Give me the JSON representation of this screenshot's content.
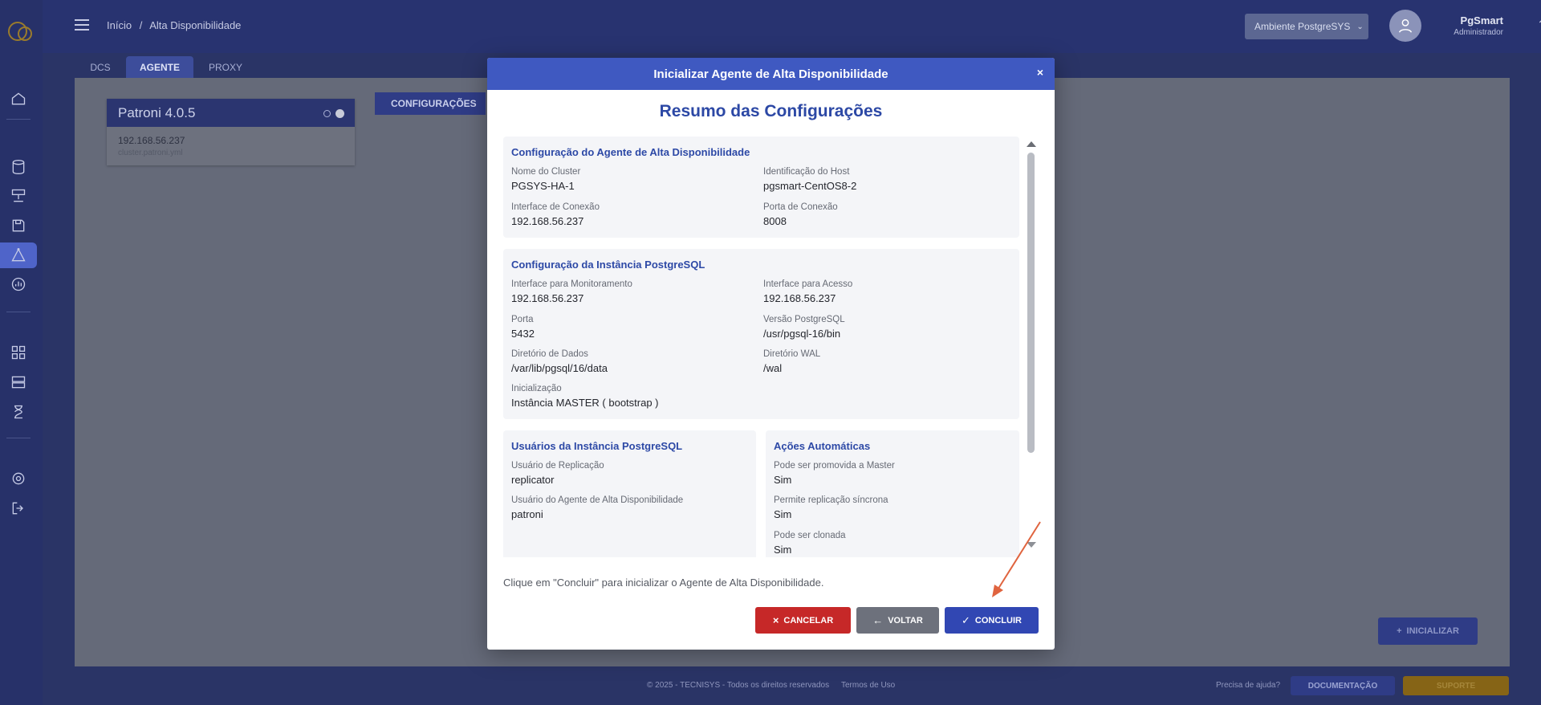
{
  "header": {
    "breadcrumb": [
      "Início",
      "/",
      "Alta Disponibilidade"
    ],
    "environment_select": "Ambiente PostgreSYS",
    "user_name": "PgSmart",
    "user_role": "Administrador"
  },
  "tabs": [
    {
      "label": "DCS"
    },
    {
      "label": "AGENTE"
    },
    {
      "label": "PROXY"
    }
  ],
  "card": {
    "title": "Patroni 4.0.5",
    "ip": "192.168.56.237",
    "subtitle": "cluster.patroni.yml"
  },
  "configuracoes_button": "CONFIGURAÇÕES",
  "initialize_button": "INICIALIZAR",
  "footer": {
    "copyright": "© 2025 - TECNISYS - Todos os direitos reservados",
    "terms": "Termos de Uso",
    "help": "Precisa de ajuda?",
    "doc_button": "DOCUMENTAÇÃO",
    "support_button": "SUPORTE"
  },
  "modal": {
    "header": "Inicializar Agente de Alta Disponibilidade",
    "close": "×",
    "title": "Resumo das Configurações",
    "agent_section": {
      "title": "Configuração do Agente de Alta Disponibilidade",
      "cluster_name_label": "Nome do Cluster",
      "cluster_name": "PGSYS-HA-1",
      "host_id_label": "Identificação do Host",
      "host_id": "pgsmart-CentOS8-2",
      "conn_iface_label": "Interface de Conexão",
      "conn_iface": "192.168.56.237",
      "conn_port_label": "Porta de Conexão",
      "conn_port": "8008"
    },
    "instance_section": {
      "title": "Configuração da Instância PostgreSQL",
      "mon_iface_label": "Interface para Monitoramento",
      "mon_iface": "192.168.56.237",
      "access_iface_label": "Interface para Acesso",
      "access_iface": "192.168.56.237",
      "port_label": "Porta",
      "port": "5432",
      "version_label": "Versão PostgreSQL",
      "version": "/usr/pgsql-16/bin",
      "data_dir_label": "Diretório de Dados",
      "data_dir": "/var/lib/pgsql/16/data",
      "wal_dir_label": "Diretório WAL",
      "wal_dir": "/wal",
      "init_label": "Inicialização",
      "init": "Instância MASTER ( bootstrap )"
    },
    "users_section": {
      "title": "Usuários da Instância PostgreSQL",
      "repl_user_label": "Usuário de Replicação",
      "repl_user": "replicator",
      "agent_user_label": "Usuário do Agente de Alta Disponibilidade",
      "agent_user": "patroni"
    },
    "actions_section": {
      "title": "Ações Automáticas",
      "promote_label": "Pode ser promovida a Master",
      "promote": "Sim",
      "sync_label": "Permite replicação síncrona",
      "sync": "Sim",
      "clone_label": "Pode ser clonada",
      "clone": "Sim"
    },
    "hint": "Clique em \"Concluir\" para inicializar o Agente de Alta Disponibilidade.",
    "cancel_button": "CANCELAR",
    "back_button": "VOLTAR",
    "done_button": "CONCLUIR"
  },
  "colors": {
    "modal_header": "#3f59c1",
    "section_title": "#2d49a6",
    "cancel": "#c62828",
    "back": "#6d717c",
    "done": "#3147b3",
    "annotation_arrow": "#e0643f"
  }
}
